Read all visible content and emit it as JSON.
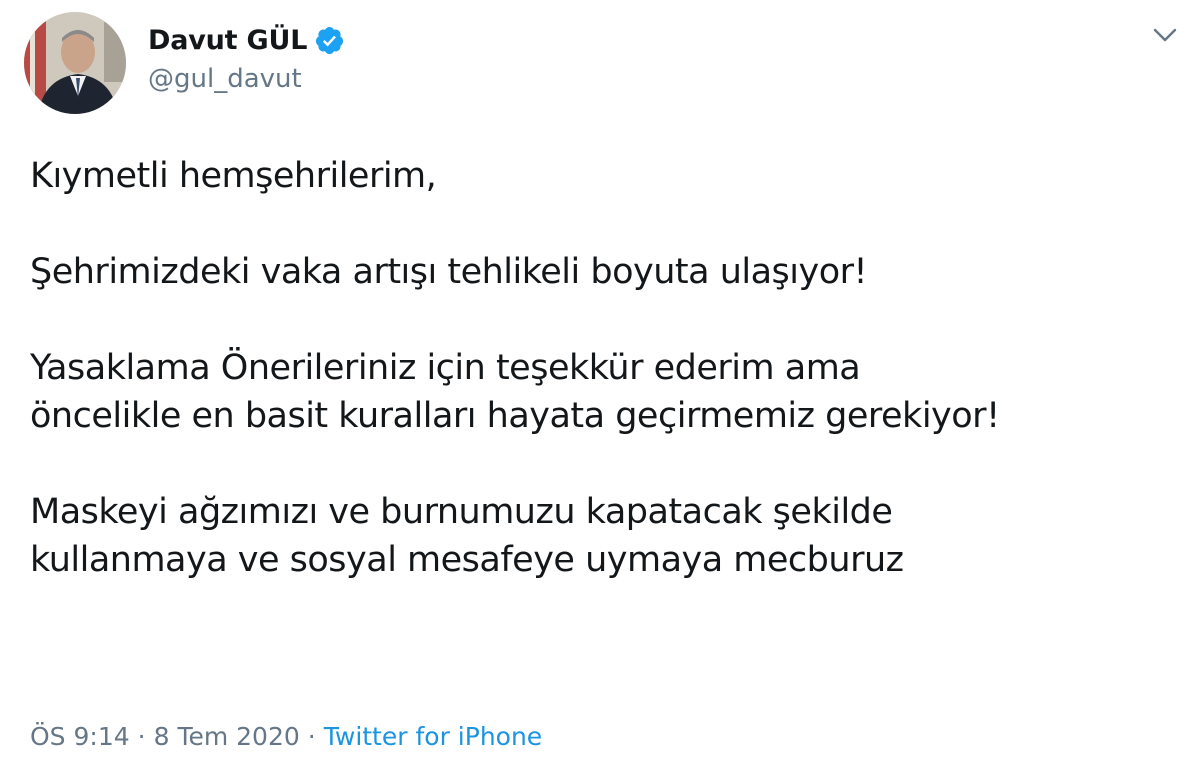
{
  "author": {
    "display_name": "Davut GÜL",
    "handle": "@gul_davut",
    "verified": true,
    "avatar": "portrait-photo"
  },
  "menu": {
    "icon": "chevron-down-icon"
  },
  "tweet": {
    "paragraphs": [
      "Kıymetli hemşehrilerim,",
      "Şehrimizdeki vaka artışı tehlikeli boyuta ulaşıyor!",
      "Yasaklama Önerileriniz için teşekkür ederim ama öncelikle en basit kuralları hayata geçirmemiz gerekiyor!",
      "Maskeyi ağzımızı ve burnumuzu kapatacak şekilde kullanmaya ve sosyal mesafeye uymaya mecburuz"
    ],
    "lines": {
      "p3_line1": "Yasaklama Önerileriniz için teşekkür ederim ama",
      "p3_line2": "öncelikle en basit kuralları hayata geçirmemiz gerekiyor!",
      "p4_line1": "Maskeyi ağzımızı ve burnumuzu kapatacak şekilde",
      "p4_line2": "kullanmaya ve sosyal mesafeye uymaya mecburuz"
    }
  },
  "meta": {
    "time": "ÖS 9:14",
    "separator": "·",
    "date": "8 Tem 2020",
    "source": "Twitter for iPhone"
  },
  "colors": {
    "text": "#14171a",
    "secondary": "#657786",
    "link": "#1b95e0",
    "verified": "#1da1f2"
  }
}
